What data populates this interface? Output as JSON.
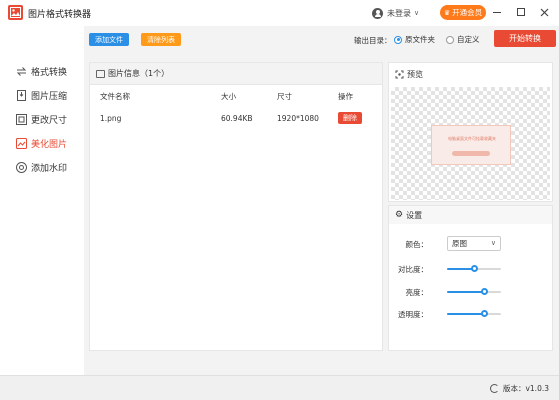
{
  "app": {
    "title": "图片格式转换器",
    "version": "版本：v1.0.3"
  },
  "user": {
    "login": "未登录",
    "vip": "开通会员"
  },
  "sidebar": {
    "items": [
      {
        "label": "格式转换",
        "active": false
      },
      {
        "label": "图片压缩",
        "active": false
      },
      {
        "label": "更改尺寸",
        "active": false
      },
      {
        "label": "美化图片",
        "active": true
      },
      {
        "label": "添加水印",
        "active": false
      }
    ]
  },
  "toolbar": {
    "add_file": "添加文件",
    "clear_list": "清除列表",
    "output_label": "输出目录：",
    "output_options": [
      "原文件夹",
      "自定义"
    ],
    "output_selected": "原文件夹",
    "start": "开始转换"
  },
  "file_panel": {
    "title": "图片信息（1个）",
    "columns": [
      "文件名称",
      "大小",
      "尺寸",
      "操作"
    ],
    "rows": [
      {
        "name": "1.png",
        "size": "60.94KB",
        "dimensions": "1920*1080",
        "action": "删除"
      }
    ]
  },
  "preview": {
    "title": "预览",
    "image_text": "电脑桌面文件可挂载收藏夹"
  },
  "settings": {
    "title": "设置",
    "color_label": "颜色：",
    "color_value": "原图",
    "contrast_label": "对比度：",
    "contrast_value": 0.5,
    "brightness_label": "亮度：",
    "brightness_value": 0.7,
    "opacity_label": "透明度：",
    "opacity_value": 0.7
  },
  "colors": {
    "accent": "#e84a33",
    "primary": "#2b8fe6",
    "warning": "#ff9a1a",
    "vip": "#ff7a1a"
  }
}
